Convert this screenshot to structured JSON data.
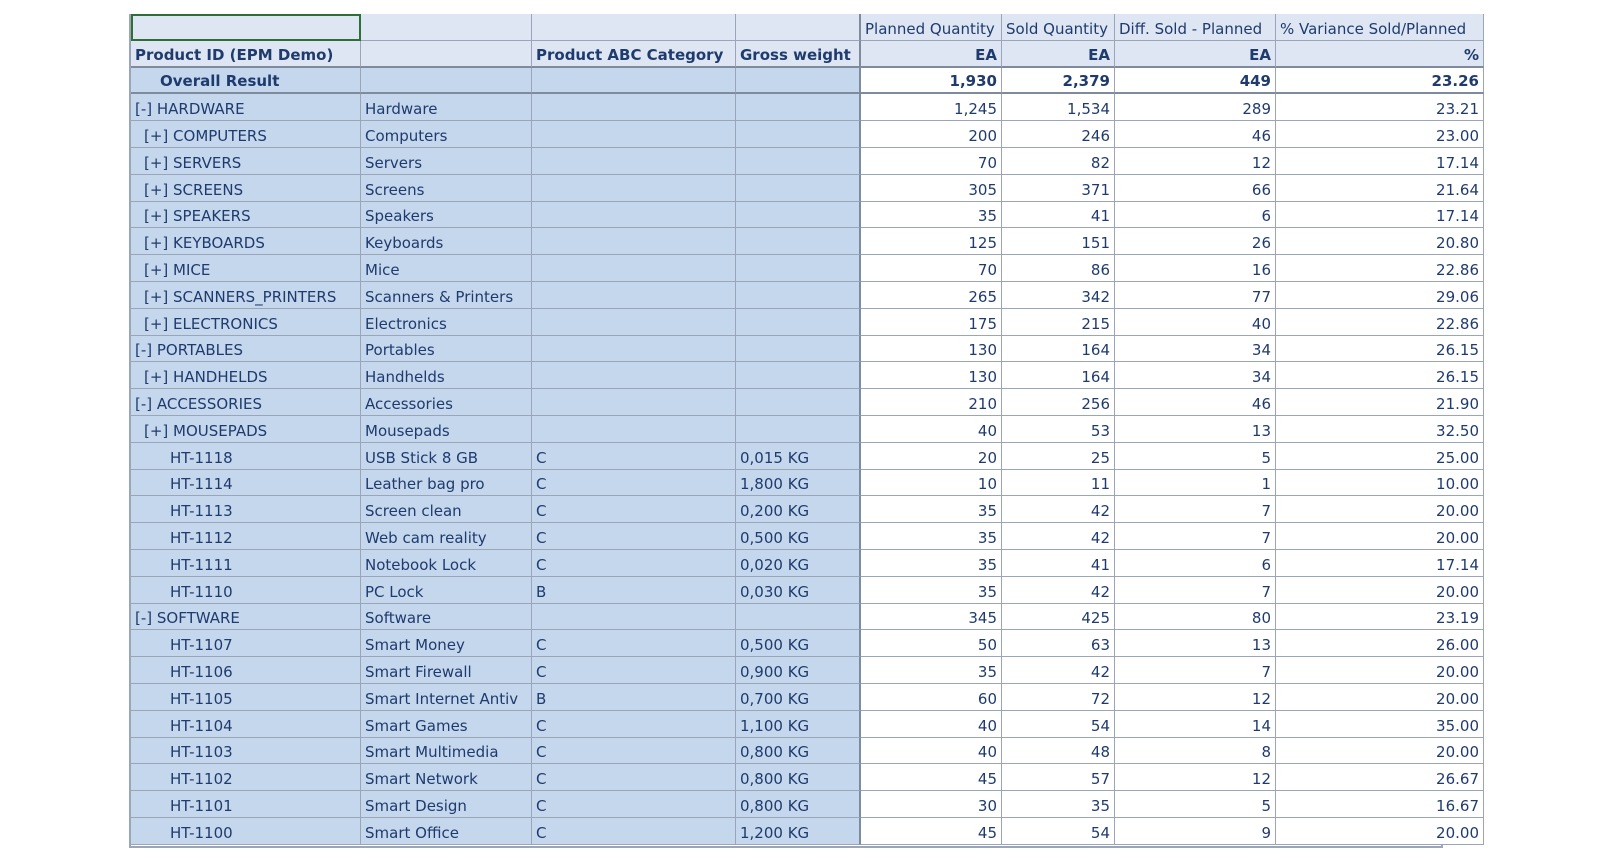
{
  "header": {
    "row1": [
      "",
      "",
      "",
      "",
      "Planned Quantity",
      "Sold Quantity",
      "Diff. Sold - Planned",
      "% Variance Sold/Planned"
    ],
    "row2": [
      "Product ID (EPM Demo)",
      "",
      "Product ABC Category",
      "Gross weight",
      "EA",
      "EA",
      "EA",
      "%"
    ]
  },
  "overall": {
    "label": "Overall Result",
    "planned": "1,930",
    "sold": "2,379",
    "diff": "449",
    "pct": "23.26"
  },
  "rows": [
    {
      "id": "[-] HARDWARE",
      "name": "Hardware",
      "abc": "",
      "weight": "",
      "planned": "1,245",
      "sold": "1,534",
      "diff": "289",
      "pct": "23.21",
      "lvl": 0
    },
    {
      "id": "[+] COMPUTERS",
      "name": "Computers",
      "abc": "",
      "weight": "",
      "planned": "200",
      "sold": "246",
      "diff": "46",
      "pct": "23.00",
      "lvl": 1
    },
    {
      "id": "[+] SERVERS",
      "name": "Servers",
      "abc": "",
      "weight": "",
      "planned": "70",
      "sold": "82",
      "diff": "12",
      "pct": "17.14",
      "lvl": 1
    },
    {
      "id": "[+] SCREENS",
      "name": "Screens",
      "abc": "",
      "weight": "",
      "planned": "305",
      "sold": "371",
      "diff": "66",
      "pct": "21.64",
      "lvl": 1
    },
    {
      "id": "[+] SPEAKERS",
      "name": "Speakers",
      "abc": "",
      "weight": "",
      "planned": "35",
      "sold": "41",
      "diff": "6",
      "pct": "17.14",
      "lvl": 1
    },
    {
      "id": "[+] KEYBOARDS",
      "name": "Keyboards",
      "abc": "",
      "weight": "",
      "planned": "125",
      "sold": "151",
      "diff": "26",
      "pct": "20.80",
      "lvl": 1
    },
    {
      "id": "[+] MICE",
      "name": "Mice",
      "abc": "",
      "weight": "",
      "planned": "70",
      "sold": "86",
      "diff": "16",
      "pct": "22.86",
      "lvl": 1
    },
    {
      "id": "[+] SCANNERS_PRINTERS",
      "name": "Scanners & Printers",
      "abc": "",
      "weight": "",
      "planned": "265",
      "sold": "342",
      "diff": "77",
      "pct": "29.06",
      "lvl": 1
    },
    {
      "id": "[+] ELECTRONICS",
      "name": "Electronics",
      "abc": "",
      "weight": "",
      "planned": "175",
      "sold": "215",
      "diff": "40",
      "pct": "22.86",
      "lvl": 1
    },
    {
      "id": "[-] PORTABLES",
      "name": "Portables",
      "abc": "",
      "weight": "",
      "planned": "130",
      "sold": "164",
      "diff": "34",
      "pct": "26.15",
      "lvl": 0
    },
    {
      "id": "[+] HANDHELDS",
      "name": "Handhelds",
      "abc": "",
      "weight": "",
      "planned": "130",
      "sold": "164",
      "diff": "34",
      "pct": "26.15",
      "lvl": 1
    },
    {
      "id": "[-] ACCESSORIES",
      "name": "Accessories",
      "abc": "",
      "weight": "",
      "planned": "210",
      "sold": "256",
      "diff": "46",
      "pct": "21.90",
      "lvl": 0
    },
    {
      "id": "[+] MOUSEPADS",
      "name": "Mousepads",
      "abc": "",
      "weight": "",
      "planned": "40",
      "sold": "53",
      "diff": "13",
      "pct": "32.50",
      "lvl": 1
    },
    {
      "id": "HT-1118",
      "name": "USB Stick 8 GB",
      "abc": "C",
      "weight": "0,015 KG",
      "planned": "20",
      "sold": "25",
      "diff": "5",
      "pct": "25.00",
      "lvl": 2
    },
    {
      "id": "HT-1114",
      "name": "Leather bag pro",
      "abc": "C",
      "weight": "1,800 KG",
      "planned": "10",
      "sold": "11",
      "diff": "1",
      "pct": "10.00",
      "lvl": 2
    },
    {
      "id": "HT-1113",
      "name": "Screen clean",
      "abc": "C",
      "weight": "0,200 KG",
      "planned": "35",
      "sold": "42",
      "diff": "7",
      "pct": "20.00",
      "lvl": 2
    },
    {
      "id": "HT-1112",
      "name": "Web cam reality",
      "abc": "C",
      "weight": "0,500 KG",
      "planned": "35",
      "sold": "42",
      "diff": "7",
      "pct": "20.00",
      "lvl": 2
    },
    {
      "id": "HT-1111",
      "name": "Notebook Lock",
      "abc": "C",
      "weight": "0,020 KG",
      "planned": "35",
      "sold": "41",
      "diff": "6",
      "pct": "17.14",
      "lvl": 2
    },
    {
      "id": "HT-1110",
      "name": "PC Lock",
      "abc": "B",
      "weight": "0,030 KG",
      "planned": "35",
      "sold": "42",
      "diff": "7",
      "pct": "20.00",
      "lvl": 2
    },
    {
      "id": "[-] SOFTWARE",
      "name": "Software",
      "abc": "",
      "weight": "",
      "planned": "345",
      "sold": "425",
      "diff": "80",
      "pct": "23.19",
      "lvl": 0
    },
    {
      "id": "HT-1107",
      "name": "Smart Money",
      "abc": "C",
      "weight": "0,500 KG",
      "planned": "50",
      "sold": "63",
      "diff": "13",
      "pct": "26.00",
      "lvl": 2
    },
    {
      "id": "HT-1106",
      "name": "Smart Firewall",
      "abc": "C",
      "weight": "0,900 KG",
      "planned": "35",
      "sold": "42",
      "diff": "7",
      "pct": "20.00",
      "lvl": 2
    },
    {
      "id": "HT-1105",
      "name": "Smart Internet Antiv",
      "abc": "B",
      "weight": "0,700 KG",
      "planned": "60",
      "sold": "72",
      "diff": "12",
      "pct": "20.00",
      "lvl": 2
    },
    {
      "id": "HT-1104",
      "name": "Smart Games",
      "abc": "C",
      "weight": "1,100 KG",
      "planned": "40",
      "sold": "54",
      "diff": "14",
      "pct": "35.00",
      "lvl": 2
    },
    {
      "id": "HT-1103",
      "name": "Smart Multimedia",
      "abc": "C",
      "weight": "0,800 KG",
      "planned": "40",
      "sold": "48",
      "diff": "8",
      "pct": "20.00",
      "lvl": 2
    },
    {
      "id": "HT-1102",
      "name": "Smart Network",
      "abc": "C",
      "weight": "0,800 KG",
      "planned": "45",
      "sold": "57",
      "diff": "12",
      "pct": "26.67",
      "lvl": 2
    },
    {
      "id": "HT-1101",
      "name": "Smart Design",
      "abc": "C",
      "weight": "0,800 KG",
      "planned": "30",
      "sold": "35",
      "diff": "5",
      "pct": "16.67",
      "lvl": 2
    },
    {
      "id": "HT-1100",
      "name": "Smart Office",
      "abc": "C",
      "weight": "1,200 KG",
      "planned": "45",
      "sold": "54",
      "diff": "9",
      "pct": "20.00",
      "lvl": 2
    }
  ]
}
